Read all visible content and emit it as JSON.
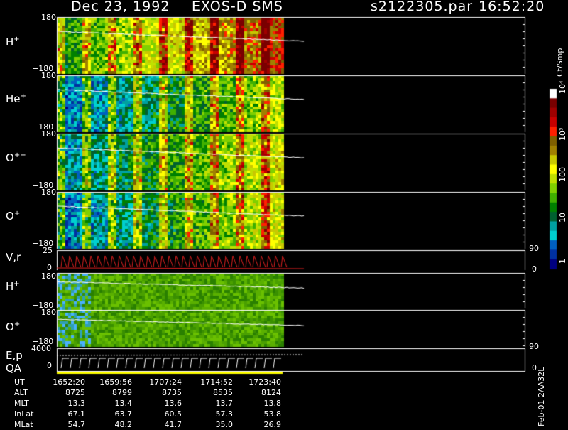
{
  "header": {
    "date": "Dec 23, 1992",
    "instrument": "EXOS-D SMS",
    "file": "s2122305.par",
    "time": "16:52:20"
  },
  "panels": [
    {
      "id": "h-plus",
      "label": "H",
      "sup": "+",
      "ymax": "180",
      "ymin": "−180",
      "palette": "spectrum"
    },
    {
      "id": "he-plus",
      "label": "He",
      "sup": "+",
      "ymax": "180",
      "ymin": "−180",
      "palette": "spectrum"
    },
    {
      "id": "o-plusplus",
      "label": "O",
      "sup": "++",
      "ymax": "180",
      "ymin": "−180",
      "palette": "spectrum"
    },
    {
      "id": "o-plus",
      "label": "O",
      "sup": "+",
      "ymax": "180",
      "ymin": "−180",
      "palette": "spectrum"
    },
    {
      "id": "vr",
      "label": "V,r",
      "sup": "",
      "ymax": "25",
      "ymin": "0",
      "rtop": "90",
      "rbot": "0",
      "palette": "line"
    },
    {
      "id": "h-plus-2",
      "label": "H",
      "sup": "+",
      "ymax": "180",
      "ymin": "−180",
      "palette": "green"
    },
    {
      "id": "o-plus-2",
      "label": "O",
      "sup": "+",
      "ymax": "180",
      "ymin": "−180",
      "palette": "green"
    },
    {
      "id": "ep-qa",
      "label": "E,p",
      "label2": "QA",
      "sup": "",
      "ymax": "4000",
      "ymin": "0",
      "rtop": "90",
      "rbot": "0",
      "palette": "line2"
    }
  ],
  "colorbar": {
    "unit": "Ct/Smp",
    "ticks": [
      "10⁴",
      "10³",
      "100",
      "10",
      "1"
    ],
    "colors": [
      "#ffffff",
      "#7a0000",
      "#a00000",
      "#c80000",
      "#ff2000",
      "#806000",
      "#a08000",
      "#c8c800",
      "#ffff00",
      "#c0e000",
      "#80d000",
      "#40b000",
      "#008000",
      "#006030",
      "#00a0a0",
      "#00d0d0",
      "#0060c0",
      "#0030a0",
      "#000080"
    ]
  },
  "ut_table": {
    "rows": [
      {
        "name": "UT",
        "values": [
          "1652:20",
          "1659:56",
          "1707:24",
          "1714:52",
          "1723:40"
        ]
      },
      {
        "name": "ALT",
        "values": [
          "8725",
          "8799",
          "8735",
          "8535",
          "8124"
        ]
      },
      {
        "name": "MLT",
        "values": [
          "13.3",
          "13.4",
          "13.6",
          "13.7",
          "13.8"
        ]
      },
      {
        "name": "InLat",
        "values": [
          "67.1",
          "63.7",
          "60.5",
          "57.3",
          "53.8"
        ]
      },
      {
        "name": "MLat",
        "values": [
          "54.7",
          "48.2",
          "41.7",
          "35.0",
          "26.9"
        ]
      }
    ]
  },
  "footer": "Feb-01 2AA32L"
}
